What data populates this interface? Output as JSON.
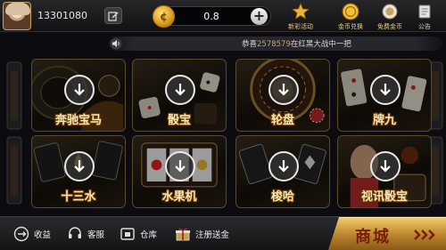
{
  "header": {
    "user_id": "13301080",
    "coin_balance": "0.8",
    "coin_symbol": "¢",
    "nav": [
      {
        "label": "新彩活动",
        "icon": "star-crown-icon"
      },
      {
        "label": "金币兑换",
        "icon": "gold-coin-exchange-icon"
      },
      {
        "label": "免费金币",
        "icon": "free-coin-icon"
      },
      {
        "label": "公告",
        "icon": "announcement-icon"
      }
    ]
  },
  "ticker": {
    "prefix": "恭喜",
    "user": "2578579",
    "middle": "在",
    "game": "红黑大战",
    "suffix": "中一把"
  },
  "games": [
    {
      "label": "奔驰宝马",
      "icon": "download-icon"
    },
    {
      "label": "骰宝",
      "icon": "download-icon"
    },
    {
      "label": "轮盘",
      "icon": "download-icon"
    },
    {
      "label": "牌九",
      "icon": "download-icon"
    },
    {
      "label": "十三水",
      "icon": "download-icon"
    },
    {
      "label": "水果机",
      "icon": "download-icon"
    },
    {
      "label": "梭哈",
      "icon": "download-icon"
    },
    {
      "label": "视讯骰宝",
      "icon": "download-icon"
    }
  ],
  "footer": {
    "items": [
      {
        "label": "收益",
        "icon": "earnings-icon"
      },
      {
        "label": "客服",
        "icon": "customer-service-icon"
      },
      {
        "label": "仓库",
        "icon": "warehouse-icon"
      },
      {
        "label": "注册送金",
        "icon": "gift-icon"
      }
    ],
    "shop_label": "商城"
  },
  "colors": {
    "accent_gold": "#e6cf95",
    "label_gold": "#f7e7b8",
    "ticker_uid": "#c8a26a",
    "shop_text": "#7a1d06"
  }
}
